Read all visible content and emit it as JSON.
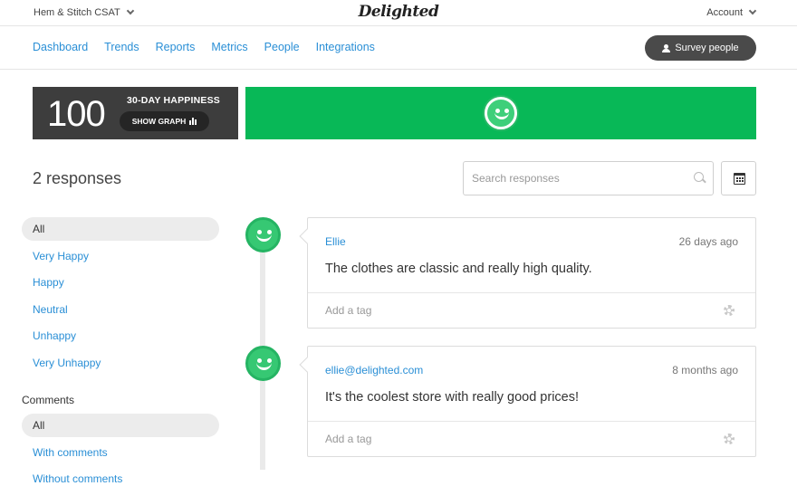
{
  "topbar": {
    "project": "Hem & Stitch CSAT",
    "logo": "Delighted",
    "account": "Account"
  },
  "nav": {
    "items": [
      "Dashboard",
      "Trends",
      "Reports",
      "Metrics",
      "People",
      "Integrations"
    ],
    "survey_button": "Survey people"
  },
  "score": {
    "value": "100",
    "label": "30-DAY HAPPINESS",
    "graph_button": "SHOW GRAPH",
    "panel_color": "#08b857"
  },
  "responses": {
    "title": "2 responses",
    "search_placeholder": "Search responses"
  },
  "sidebar": {
    "happiness_filters": [
      "All",
      "Very Happy",
      "Happy",
      "Neutral",
      "Unhappy",
      "Very Unhappy"
    ],
    "comments_heading": "Comments",
    "comment_filters": [
      "All",
      "With comments",
      "Without comments"
    ]
  },
  "cards": [
    {
      "name": "Ellie",
      "date": "26 days ago",
      "text": "The clothes are classic and really high quality.",
      "tag_placeholder": "Add a tag"
    },
    {
      "name": "ellie@delighted.com",
      "date": "8 months ago",
      "text": "It's the coolest store with really good prices!",
      "tag_placeholder": "Add a tag"
    }
  ],
  "colors": {
    "link": "#2a8fd6",
    "happy_green": "#08b857",
    "dark_panel": "#3d3d3d"
  }
}
